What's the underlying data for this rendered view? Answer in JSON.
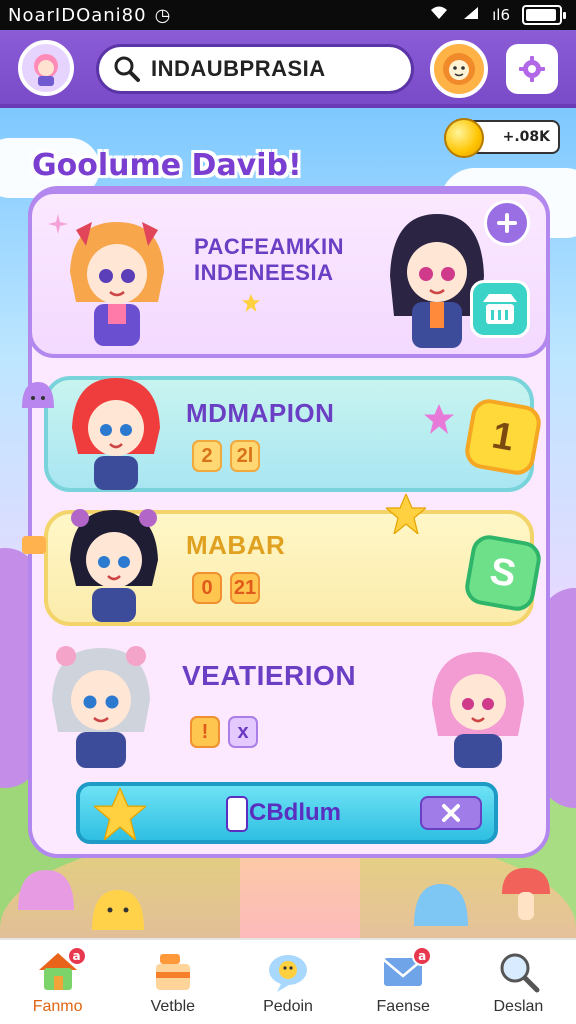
{
  "status_bar": {
    "clock": "NoarIDOani80",
    "network": "ıl6"
  },
  "top_bar": {
    "search_text": "INDAUBPRASIA"
  },
  "coins": {
    "value": "+.08K"
  },
  "header": {
    "title": "Goolume Davib!"
  },
  "cards": [
    {
      "title_line1": "PACFEAMKIN",
      "title_line2": "INDENEESIA"
    },
    {
      "title": "MDMAPION",
      "pills": [
        "2",
        "2l"
      ],
      "badge": "1"
    },
    {
      "title": "MABAR",
      "pills": [
        "0",
        "21"
      ],
      "badge": "S"
    },
    {
      "title": "VEATIERION",
      "pills": [
        "!",
        "x"
      ]
    }
  ],
  "action_bar": {
    "label": "CBdlum"
  },
  "bottom_nav": {
    "items": [
      {
        "label": "Fanmo",
        "icon": "house-icon",
        "badge": "a",
        "active": true
      },
      {
        "label": "Vetble",
        "icon": "cake-icon"
      },
      {
        "label": "Pedoin",
        "icon": "chat-bubble-icon"
      },
      {
        "label": "Faense",
        "icon": "envelope-icon",
        "badge": "a"
      },
      {
        "label": "Deslan",
        "icon": "magnifier-icon"
      }
    ]
  },
  "colors": {
    "brand_purple": "#8b5cd6",
    "accent_orange": "#e06412",
    "badge_red": "#e8384f"
  }
}
